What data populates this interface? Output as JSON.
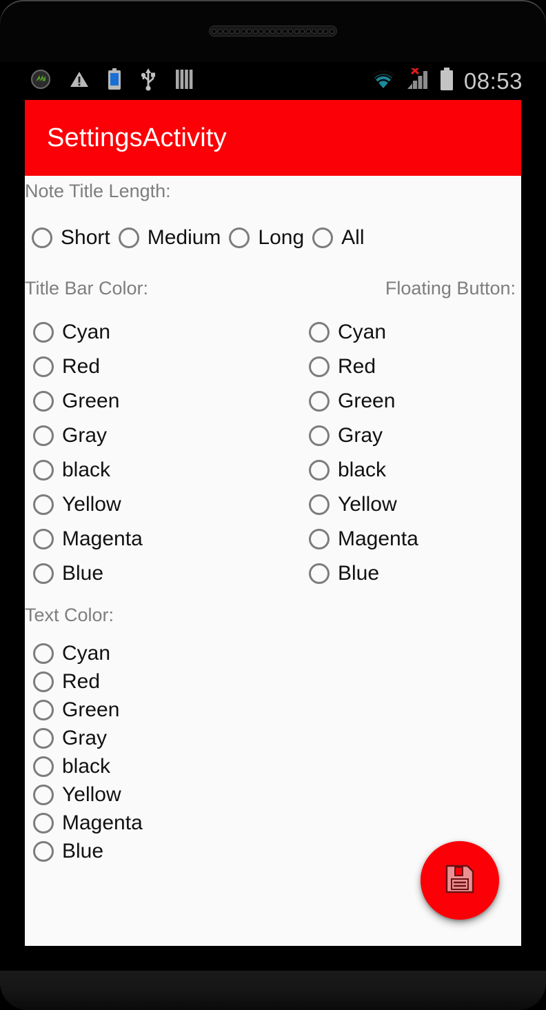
{
  "device": {
    "speaker_holes": 21
  },
  "status_bar": {
    "icons": [
      {
        "name": "app-notification-icon"
      },
      {
        "name": "warning-triangle-icon"
      },
      {
        "name": "battery-notification-icon"
      },
      {
        "name": "usb-icon"
      },
      {
        "name": "sim-bars-icon"
      }
    ],
    "wifi_icon": "wifi-icon",
    "signal_icon": "cell-signal-no-service-icon",
    "battery_icon": "battery-full-icon",
    "time": "08:53"
  },
  "app": {
    "title": "SettingsActivity",
    "title_bar_color": "#FB0007"
  },
  "note_title_length": {
    "label": "Note Title Length:",
    "options": [
      {
        "label": "Short",
        "selected": false
      },
      {
        "label": "Medium",
        "selected": false
      },
      {
        "label": "Long",
        "selected": false
      },
      {
        "label": "All",
        "selected": false
      }
    ]
  },
  "title_bar_color": {
    "label": "Title Bar Color:",
    "options": [
      {
        "label": "Cyan",
        "selected": false
      },
      {
        "label": "Red",
        "selected": false
      },
      {
        "label": "Green",
        "selected": false
      },
      {
        "label": "Gray",
        "selected": false
      },
      {
        "label": "black",
        "selected": false
      },
      {
        "label": "Yellow",
        "selected": false
      },
      {
        "label": "Magenta",
        "selected": false
      },
      {
        "label": "Blue",
        "selected": false
      }
    ]
  },
  "floating_button": {
    "label": "Floating Button:",
    "options": [
      {
        "label": "Cyan",
        "selected": false
      },
      {
        "label": "Red",
        "selected": false
      },
      {
        "label": "Green",
        "selected": false
      },
      {
        "label": "Gray",
        "selected": false
      },
      {
        "label": "black",
        "selected": false
      },
      {
        "label": "Yellow",
        "selected": false
      },
      {
        "label": "Magenta",
        "selected": false
      },
      {
        "label": "Blue",
        "selected": false
      }
    ]
  },
  "text_color": {
    "label": "Text Color:",
    "options": [
      {
        "label": "Cyan",
        "selected": false
      },
      {
        "label": "Red",
        "selected": false
      },
      {
        "label": "Green",
        "selected": false
      },
      {
        "label": "Gray",
        "selected": false
      },
      {
        "label": "black",
        "selected": false
      },
      {
        "label": "Yellow",
        "selected": false
      },
      {
        "label": "Magenta",
        "selected": false
      },
      {
        "label": "Blue",
        "selected": false
      }
    ]
  },
  "fab": {
    "icon": "save-floppy-disk-icon",
    "background_color": "#FB0007",
    "icon_color": "#E99193"
  },
  "colors": {
    "screen_background": "#FAFAFA",
    "label_gray": "#7E7E7E",
    "radio_outline": "#7C7C7C",
    "option_text": "#111111",
    "status_text": "#C9C9C9"
  }
}
